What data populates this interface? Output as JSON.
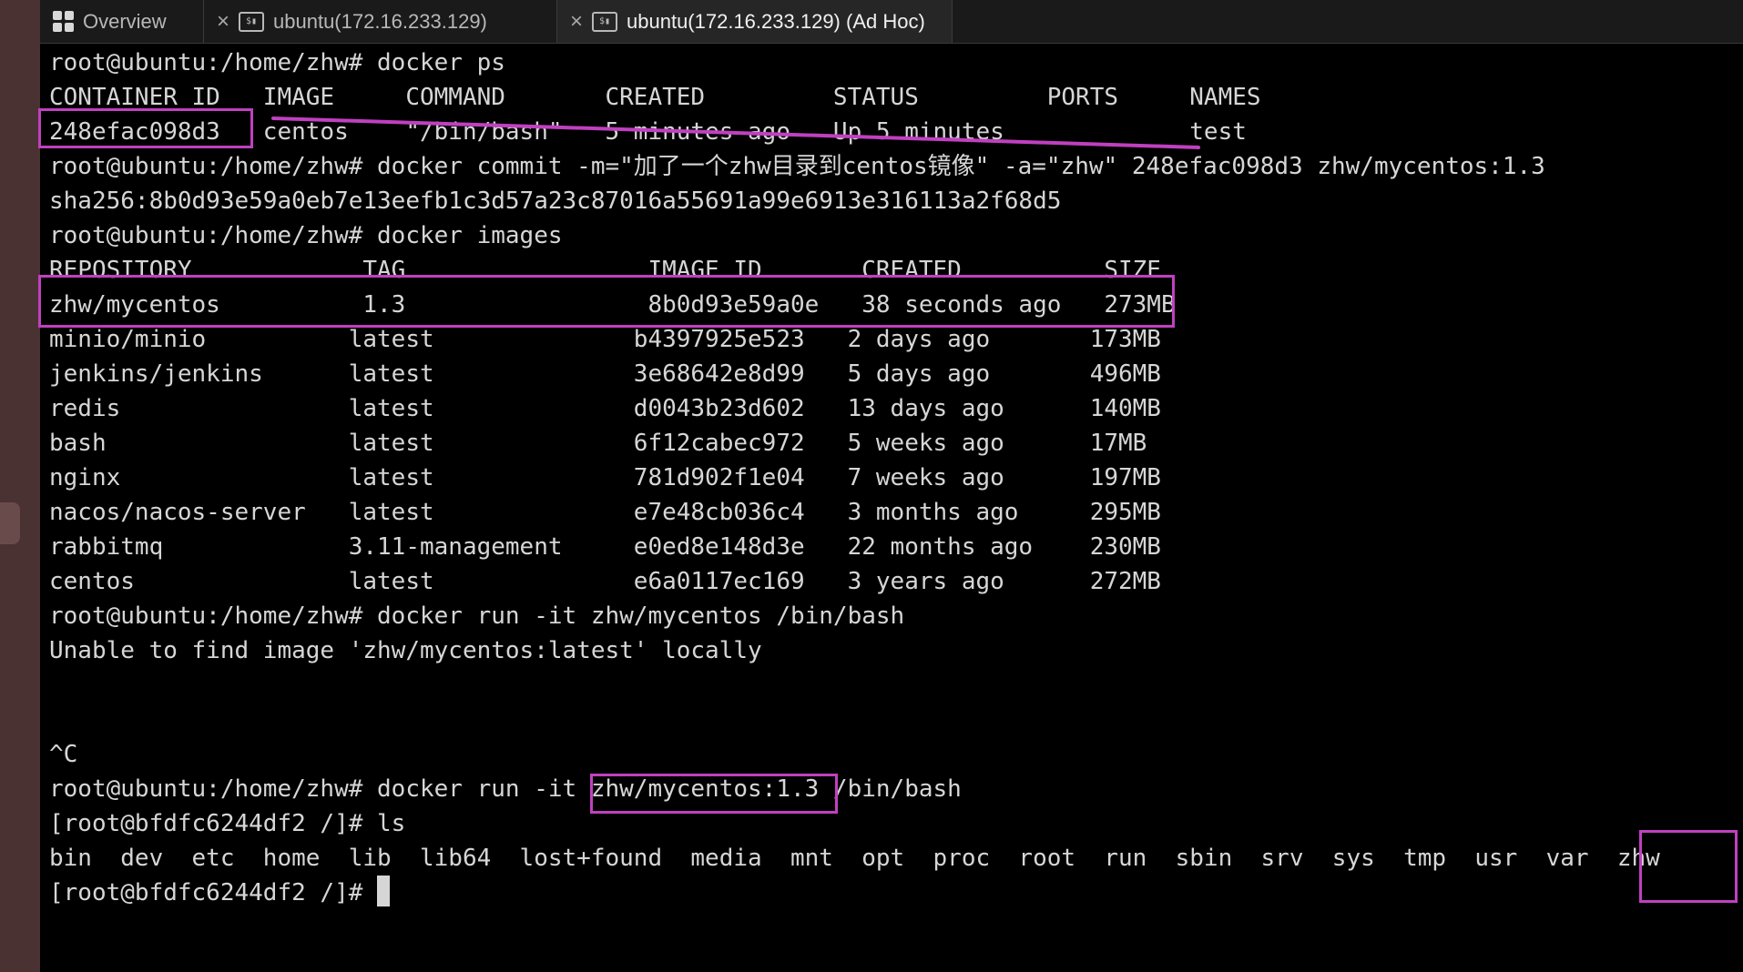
{
  "tabs": [
    {
      "label": "Overview",
      "icon": "grid-icon"
    },
    {
      "label": "ubuntu(172.16.233.129)",
      "icon": "terminal-icon"
    },
    {
      "label": "ubuntu(172.16.233.129) (Ad Hoc)",
      "icon": "terminal-icon"
    }
  ],
  "terminal": {
    "lines": [
      "root@ubuntu:/home/zhw# docker ps",
      "CONTAINER ID   IMAGE     COMMAND       CREATED         STATUS         PORTS     NAMES",
      "248efac098d3   centos    \"/bin/bash\"   5 minutes ago   Up 5 minutes             test",
      "root@ubuntu:/home/zhw# docker commit -m=\"加了一个zhw目录到centos镜像\" -a=\"zhw\" 248efac098d3 zhw/mycentos:1.3",
      "sha256:8b0d93e59a0eb7e13eefb1c3d57a23c87016a55691a99e6913e316113a2f68d5",
      "root@ubuntu:/home/zhw# docker images",
      "REPOSITORY            TAG                 IMAGE ID       CREATED          SIZE",
      "zhw/mycentos          1.3                 8b0d93e59a0e   38 seconds ago   273MB",
      "minio/minio          latest              b4397925e523   2 days ago       173MB",
      "jenkins/jenkins      latest              3e68642e8d99   5 days ago       496MB",
      "redis                latest              d0043b23d602   13 days ago      140MB",
      "bash                 latest              6f12cabec972   5 weeks ago      17MB",
      "nginx                latest              781d902f1e04   7 weeks ago      197MB",
      "nacos/nacos-server   latest              e7e48cb036c4   3 months ago     295MB",
      "rabbitmq             3.11-management     e0ed8e148d3e   22 months ago    230MB",
      "centos               latest              e6a0117ec169   3 years ago      272MB",
      "root@ubuntu:/home/zhw# docker run -it zhw/mycentos /bin/bash",
      "Unable to find image 'zhw/mycentos:latest' locally",
      "",
      "",
      "^C",
      "root@ubuntu:/home/zhw# docker run -it zhw/mycentos:1.3 /bin/bash",
      "[root@bfdfc6244df2 /]# ls",
      "bin  dev  etc  home  lib  lib64  lost+found  media  mnt  opt  proc  root  run  sbin  srv  sys  tmp  usr  var  zhw",
      "[root@bfdfc6244df2 /]# "
    ]
  },
  "colors": {
    "annotation": "#c040c0",
    "terminal_text": "#d6d6d6",
    "background": "#000000"
  }
}
